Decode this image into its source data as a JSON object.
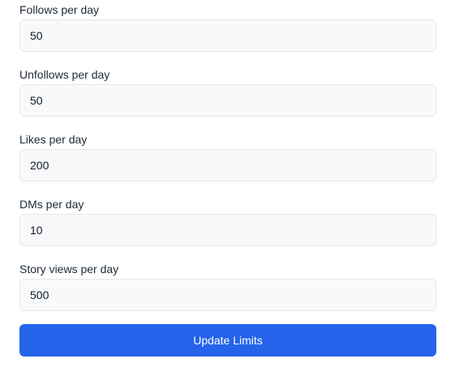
{
  "limits": {
    "fields": [
      {
        "label": "Follows per day",
        "value": "50"
      },
      {
        "label": "Unfollows per day",
        "value": "50"
      },
      {
        "label": "Likes per day",
        "value": "200"
      },
      {
        "label": "DMs per day",
        "value": "10"
      },
      {
        "label": "Story views per day",
        "value": "500"
      }
    ],
    "submit_label": "Update Limits"
  },
  "colors": {
    "primary": "#2563eb",
    "input_bg": "#f8f9fb",
    "input_border": "#e5e7eb"
  }
}
